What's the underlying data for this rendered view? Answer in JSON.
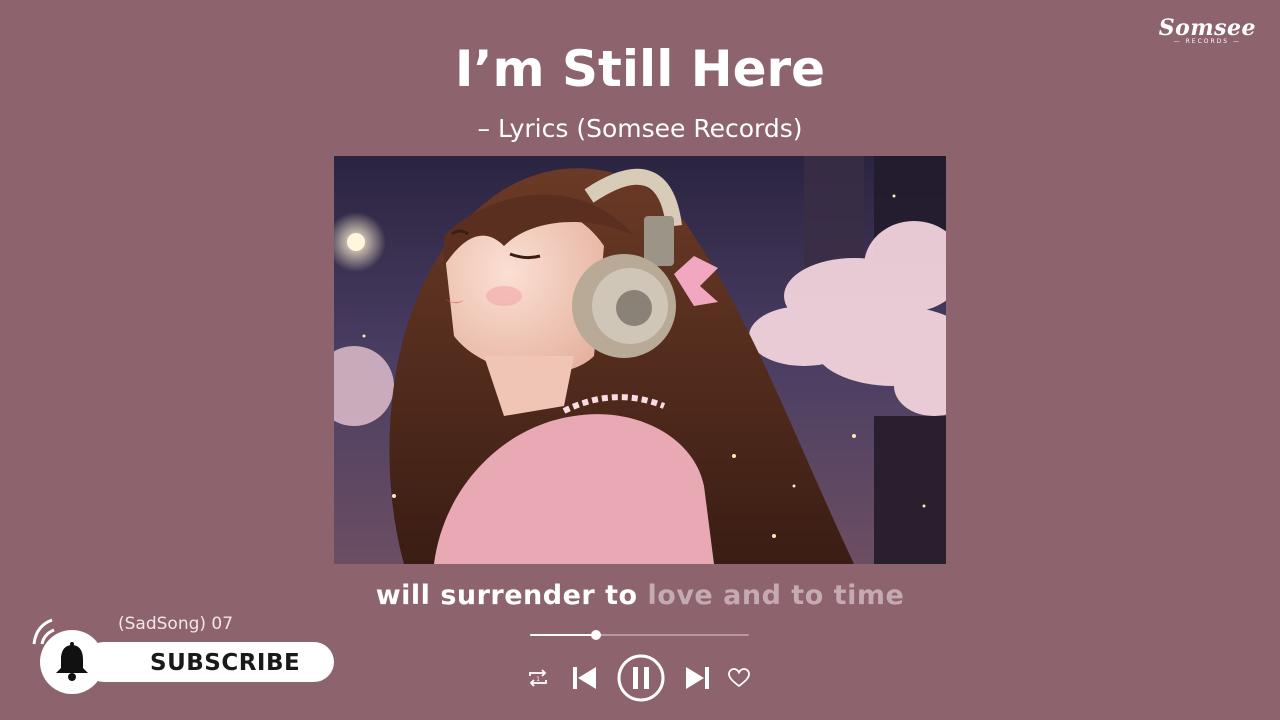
{
  "brand": {
    "logo": "Somsee",
    "logo_sub": "— RECORDS —"
  },
  "header": {
    "title": "I’m Still Here",
    "subtitle": "– Lyrics (Somsee Records)"
  },
  "artwork": {
    "icon": "anime-girl-headphones-illustration"
  },
  "lyrics": {
    "sung": "will surrender to",
    "upcoming": "love and to time"
  },
  "player": {
    "progress_percent": 30,
    "controls": [
      "repeat-icon",
      "previous-icon",
      "pause-icon",
      "next-icon",
      "heart-icon"
    ]
  },
  "subscribe": {
    "tag": "(SadSong) 07",
    "label": "SUBSCRIBE"
  },
  "colors": {
    "background": "#8d636e",
    "text": "#ffffff",
    "dim_lyric": "#c6aab1"
  }
}
